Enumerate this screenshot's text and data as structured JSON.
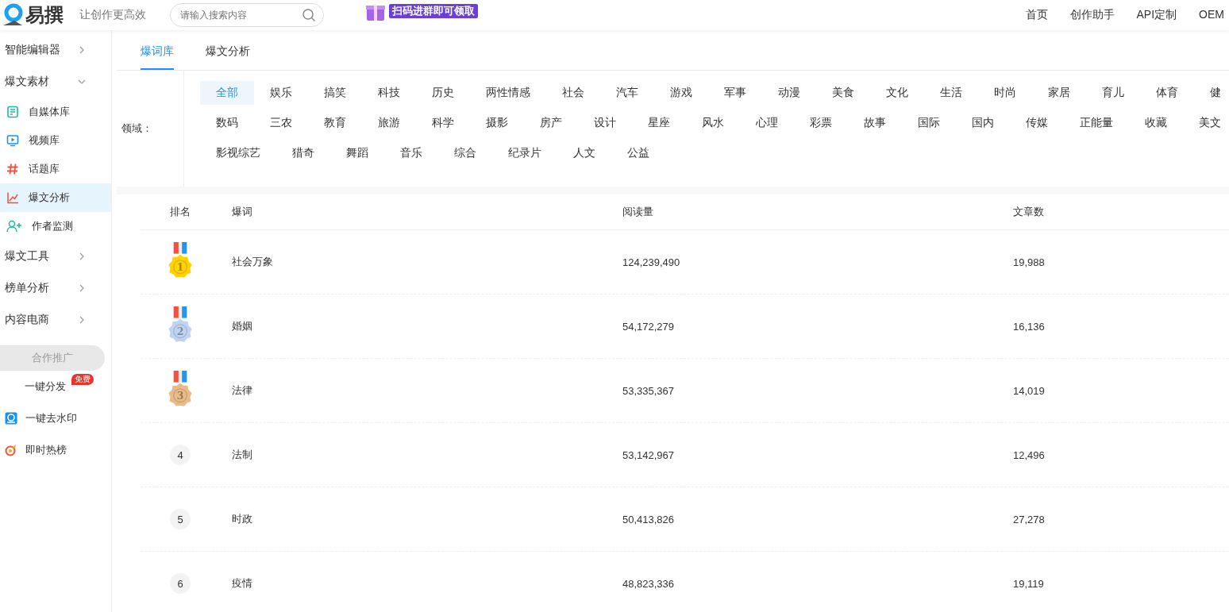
{
  "header": {
    "logo_text": "易撰",
    "slogan": "让创作更高效",
    "search": {
      "placeholder": "请输入搜索内容"
    },
    "banner": "扫码进群即可领取",
    "nav": [
      "首页",
      "创作助手",
      "API定制",
      "OEM"
    ]
  },
  "sidebar": {
    "items": [
      {
        "label": "智能编辑器",
        "expanded": false
      },
      {
        "label": "爆文素材",
        "expanded": true,
        "children": [
          {
            "label": "自媒体库",
            "selected": false
          },
          {
            "label": "视频库",
            "selected": false
          },
          {
            "label": "话题库",
            "selected": false
          },
          {
            "label": "爆文分析",
            "selected": true
          },
          {
            "label": "作者监测",
            "selected": false
          }
        ]
      },
      {
        "label": "爆文工具",
        "expanded": false
      },
      {
        "label": "榜单分析",
        "expanded": false
      },
      {
        "label": "内容电商",
        "expanded": false
      }
    ],
    "promo_button": "合作推广",
    "links": [
      {
        "label": "一键分发",
        "badge": "免费"
      },
      {
        "label": "一键去水印"
      },
      {
        "label": "即时热榜"
      }
    ]
  },
  "tabs": [
    {
      "label": "爆词库",
      "selected": true
    },
    {
      "label": "爆文分析",
      "selected": false
    }
  ],
  "filter": {
    "label": "领域：",
    "rows": [
      {
        "options": [
          {
            "label": "全部",
            "selected": true
          },
          {
            "label": "娱乐",
            "selected": false
          },
          {
            "label": "搞笑",
            "selected": false
          },
          {
            "label": "科技",
            "selected": false
          },
          {
            "label": "历史",
            "selected": false
          },
          {
            "label": "两性情感",
            "selected": false
          },
          {
            "label": "社会",
            "selected": false
          },
          {
            "label": "汽车",
            "selected": false
          },
          {
            "label": "游戏",
            "selected": false
          },
          {
            "label": "军事",
            "selected": false
          },
          {
            "label": "动漫",
            "selected": false
          },
          {
            "label": "美食",
            "selected": false
          },
          {
            "label": "文化",
            "selected": false
          },
          {
            "label": "生活",
            "selected": false
          },
          {
            "label": "时尚",
            "selected": false
          },
          {
            "label": "家居",
            "selected": false
          },
          {
            "label": "育儿",
            "selected": false
          },
          {
            "label": "体育",
            "selected": false
          },
          {
            "label": "健",
            "selected": false
          }
        ]
      },
      {
        "options": [
          {
            "label": "数码",
            "selected": false
          },
          {
            "label": "三农",
            "selected": false
          },
          {
            "label": "教育",
            "selected": false
          },
          {
            "label": "旅游",
            "selected": false
          },
          {
            "label": "科学",
            "selected": false
          },
          {
            "label": "摄影",
            "selected": false
          },
          {
            "label": "房产",
            "selected": false
          },
          {
            "label": "设计",
            "selected": false
          },
          {
            "label": "星座",
            "selected": false
          },
          {
            "label": "风水",
            "selected": false
          },
          {
            "label": "心理",
            "selected": false
          },
          {
            "label": "彩票",
            "selected": false
          },
          {
            "label": "故事",
            "selected": false
          },
          {
            "label": "国际",
            "selected": false
          },
          {
            "label": "国内",
            "selected": false
          },
          {
            "label": "传媒",
            "selected": false
          },
          {
            "label": "正能量",
            "selected": false
          },
          {
            "label": "收藏",
            "selected": false
          },
          {
            "label": "美文",
            "selected": false
          }
        ]
      },
      {
        "options": [
          {
            "label": "影视综艺",
            "selected": false
          },
          {
            "label": "猎奇",
            "selected": false
          },
          {
            "label": "舞蹈",
            "selected": false
          },
          {
            "label": "音乐",
            "selected": false
          },
          {
            "label": "综合",
            "selected": false
          },
          {
            "label": "纪录片",
            "selected": false
          },
          {
            "label": "人文",
            "selected": false
          },
          {
            "label": "公益",
            "selected": false
          }
        ]
      }
    ]
  },
  "table": {
    "columns": [
      "排名",
      "爆词",
      "阅读量",
      "文章数"
    ],
    "rows": [
      {
        "rank": "1",
        "kind": "medal",
        "color": "#ffd200",
        "keyword": "社会万象",
        "reads": "124,239,490",
        "articles": "19,988"
      },
      {
        "rank": "2",
        "kind": "medal",
        "color": "#bfd3f2",
        "keyword": "婚姻",
        "reads": "54,172,279",
        "articles": "16,136"
      },
      {
        "rank": "3",
        "kind": "medal",
        "color": "#e8bb88",
        "keyword": "法律",
        "reads": "53,335,367",
        "articles": "14,019"
      },
      {
        "rank": "4",
        "kind": "plain",
        "keyword": "法制",
        "reads": "53,142,967",
        "articles": "12,496"
      },
      {
        "rank": "5",
        "kind": "plain",
        "keyword": "时政",
        "reads": "50,413,826",
        "articles": "27,278"
      },
      {
        "rank": "6",
        "kind": "plain",
        "keyword": "疫情",
        "reads": "48,823,336",
        "articles": "19,119"
      }
    ]
  }
}
